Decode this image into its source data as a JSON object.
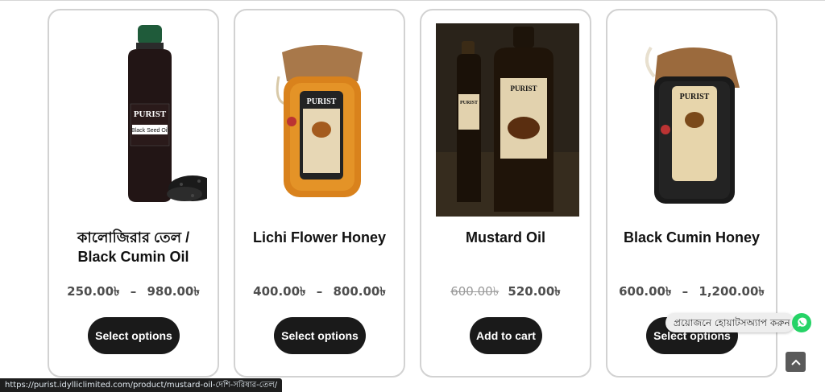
{
  "products": [
    {
      "title_line1": "কালোজিরার তেল /",
      "title_line2": "Black Cumin Oil",
      "price_min": "250.00৳",
      "price_dash": "–",
      "price_max": "980.00৳",
      "button": "Select options",
      "label_brand": "PURIST",
      "label_text": "Black Seed Oil"
    },
    {
      "title_line1": "Lichi Flower Honey",
      "price_min": "400.00৳",
      "price_dash": "–",
      "price_max": "800.00৳",
      "button": "Select options",
      "label_brand": "PURIST"
    },
    {
      "title_line1": "Mustard Oil",
      "price_old": "600.00৳",
      "price_new": "520.00৳",
      "button": "Add to cart",
      "label_brand": "PURIST"
    },
    {
      "title_line1": "Black Cumin Honey",
      "price_min": "600.00৳",
      "price_dash": "–",
      "price_max": "1,200.00৳",
      "button": "Select options",
      "label_brand": "PURIST"
    }
  ],
  "status_url": "https://purist.idylliclimited.com/product/mustard-oil-দেশি-সরিষার-তেল/",
  "whatsapp": {
    "text": "প্রয়োজনে হোয়াটসঅ্যাপ করুন",
    "color": "#25d366"
  },
  "colors": {
    "button_bg": "#1a1a1a",
    "card_border": "#d2d2d2",
    "price": "#4e4e4e"
  }
}
